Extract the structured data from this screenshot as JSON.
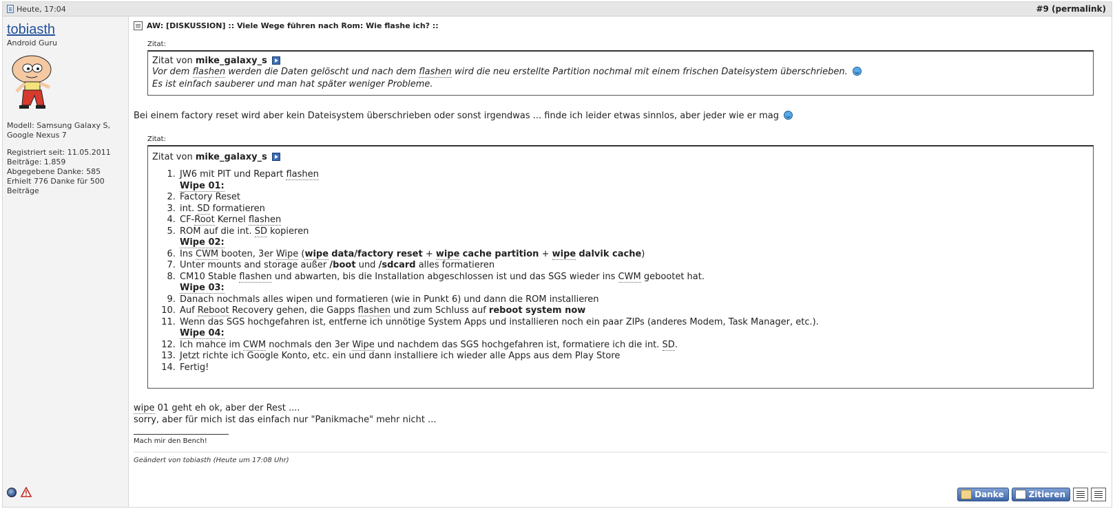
{
  "header": {
    "date": "Heute, 17:04",
    "post_number": "#9",
    "permalink": "(permalink)"
  },
  "user": {
    "name": "tobiasth",
    "title": "Android Guru",
    "model_line1": "Modell: Samsung Galaxy S,",
    "model_line2": "Google Nexus 7",
    "registered": "Registriert seit: 11.05.2011",
    "posts": "Beiträge: 1.859",
    "thanks_given": "Abgegebene Danke: 585",
    "thanks_received_1": "Erhielt 776 Danke für 500",
    "thanks_received_2": "Beiträge"
  },
  "post": {
    "title": "AW: [DISKUSSION] :: Viele Wege führen nach Rom: Wie flashe ich? ::",
    "quote1": {
      "label": "Zitat:",
      "prefix": "Zitat von",
      "author": "mike_galaxy_s",
      "line1_a": "Vor dem",
      "line1_b": "flashen",
      "line1_c": "werden die Daten gelöscht und nach dem",
      "line1_d": "flashen",
      "line1_e": "wird die neu erstellte Partition nochmal mit einem frischen Dateisystem überschrieben.",
      "line2": "Es ist einfach sauberer und man hat später weniger Probleme."
    },
    "reply1": "Bei einem factory reset wird aber kein Dateisystem überschrieben oder sonst irgendwas ... finde ich leider etwas sinnlos, aber jeder wie er mag",
    "quote2": {
      "label": "Zitat:",
      "prefix": "Zitat von",
      "author": "mike_galaxy_s",
      "s1_a": "JW6 mit PIT und Repart",
      "s1_b": "flashen",
      "wipe01": "Wipe 01:",
      "s2": "Factory Reset",
      "s3_a": "int.",
      "s3_b": "SD",
      "s3_c": "formatieren",
      "s4_a": "CF-",
      "s4_b": "Root",
      "s4_c": "Kernel",
      "s4_d": "flashen",
      "s5_a": "ROM auf die int.",
      "s5_b": "SD",
      "s5_c": "kopieren",
      "wipe02": "Wipe 02:",
      "s6_a": "Ins",
      "s6_b": "CWM",
      "s6_c": "booten, 3er",
      "s6_d": "Wipe",
      "s6_e": "(",
      "s6_f": "wipe",
      "s6_g": "data/factory reset",
      "s6_h": "+",
      "s6_i": "wipe",
      "s6_j": "cache partition",
      "s6_k": "+",
      "s6_l": "wipe",
      "s6_m": "dalvik cache",
      "s6_n": ")",
      "s7_a": "Unter mounts and storage außer",
      "s7_b": "/boot",
      "s7_c": "und",
      "s7_d": "/sdcard",
      "s7_e": "alles formatieren",
      "s8_a": "CM10 Stable",
      "s8_b": "flashen",
      "s8_c": "und abwarten, bis die Installation abgeschlossen ist und das SGS wieder ins",
      "s8_d": "CWM",
      "s8_e": "gebootet hat.",
      "wipe03": "Wipe 03:",
      "s9": "Danach nochmals alles wipen und formatieren (wie in Punkt 6) und dann die ROM installieren",
      "s10_a": "Auf",
      "s10_b": "Reboot",
      "s10_c": "Recovery gehen, die Gapps",
      "s10_d": "flashen",
      "s10_e": "und zum Schluss auf",
      "s10_f": "reboot system now",
      "s11": "Wenn das SGS hochgefahren ist, entferne ich unnötige System Apps und installieren noch ein paar ZIPs (anderes Modem, Task Manager, etc.).",
      "wipe04": "Wipe 04:",
      "s12_a": "Ich mahce im",
      "s12_b": "CWM",
      "s12_c": "nochmals den 3er",
      "s12_d": "Wipe",
      "s12_e": "und nachdem das SGS hochgefahren ist, formatiere ich die int.",
      "s12_f": "SD",
      "s12_g": ".",
      "s13": "Jetzt richte ich Google Konto, etc. ein und dann installiere ich wieder alle Apps aus dem Play Store",
      "s14": "Fertig!"
    },
    "reply2_a": "wipe",
    "reply2_b": "01 geht eh ok, aber der Rest ....",
    "reply2_line2": "sorry, aber für mich ist das einfach nur \"Panikmache\" mehr nicht ...",
    "signature": "Mach mir den Bench!",
    "edited": "Geändert von tobiasth (Heute um 17:08 Uhr)"
  },
  "actions": {
    "thanks_label": "Danke",
    "quote_label": "Zitieren"
  },
  "icons": [
    "doc-icon",
    "title-icon",
    "arrow-icon",
    "smiley-icon",
    "status-icon",
    "report-icon",
    "thanks-icon",
    "quote-icon",
    "multiquote-icon",
    "edit-icon"
  ],
  "colors": {
    "username": "#1f4f9a",
    "button": "#3e66a8",
    "header_bg": "#e6e6e6",
    "sidebar_bg": "#f3f3f3"
  }
}
